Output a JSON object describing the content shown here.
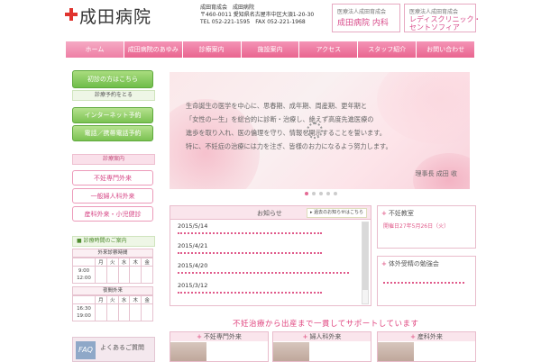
{
  "header": {
    "logo_text": "成田病院",
    "address_lines": [
      "成田育成会　成田病院",
      "〒460-0011 愛知県名古屋市中区大須1-20-30",
      "TEL 052-221-1595　FAX 052-221-1968"
    ],
    "box1_small": "医療法人成田育成会",
    "box1_big": "成田病院 内科",
    "box2_small": "医療法人成田育成会",
    "box2_big1": "レディスクリニック・",
    "box2_big2": "セントソフィア"
  },
  "nav": {
    "items": [
      "ホーム",
      "成田病院のあゆみ",
      "診療案内",
      "施設案内",
      "アクセス",
      "スタッフ紹介",
      "お問い合わせ"
    ]
  },
  "sidebar": {
    "first_visit": "初診の方はこちら",
    "reserve_label": "診療予約をとる",
    "internet_reserve": "インターネット予約",
    "phone_reserve": "電話／携帯電話予約",
    "guide_head": "診療案内",
    "guide_items": [
      "不妊専門外来",
      "一般婦人科外来",
      "産科外来・小児健診"
    ],
    "hours_head": "診療時間のご案内",
    "hours_am_caption": "外来診察時間",
    "hours_pm_caption": "夜間外来",
    "days": [
      "月",
      "火",
      "水",
      "木",
      "金"
    ],
    "am_times": [
      "9:00",
      "12:00"
    ],
    "pm_times": [
      "16:30",
      "19:00"
    ],
    "faq_icon": "FAQ",
    "faq_label": "よくあるご質問"
  },
  "hero": {
    "lines": [
      "生命誕生の医学を中心に、思春期、成年期、周産期、更年期と",
      "「女性の一生」を総合的に診断・治療し、絶えず高度先進医療の",
      "進歩を取り入れ、医の倫理を守り、情報を開示することを誓います。",
      "特に、不妊症の治療には力を注ぎ、皆様のお力になるよう努力します。"
    ],
    "signature": "理事長 成田 收"
  },
  "news": {
    "title": "お知らせ",
    "past_button": "過去のお知らせはこちら",
    "items": [
      {
        "date": "2015/5/14"
      },
      {
        "date": "2015/4/21"
      },
      {
        "date": "2015/4/20"
      },
      {
        "date": "2015/3/12"
      }
    ]
  },
  "right": {
    "box1_title": "不妊教室",
    "box1_date": "開催日27年5月26日（火）",
    "box2_title": "体外受精の勉強会"
  },
  "bottom": {
    "tagline": "不妊治療から出産まで一貫してサポートしています",
    "cards": [
      "不妊専門外来",
      "婦人科外来",
      "産科外来"
    ]
  }
}
